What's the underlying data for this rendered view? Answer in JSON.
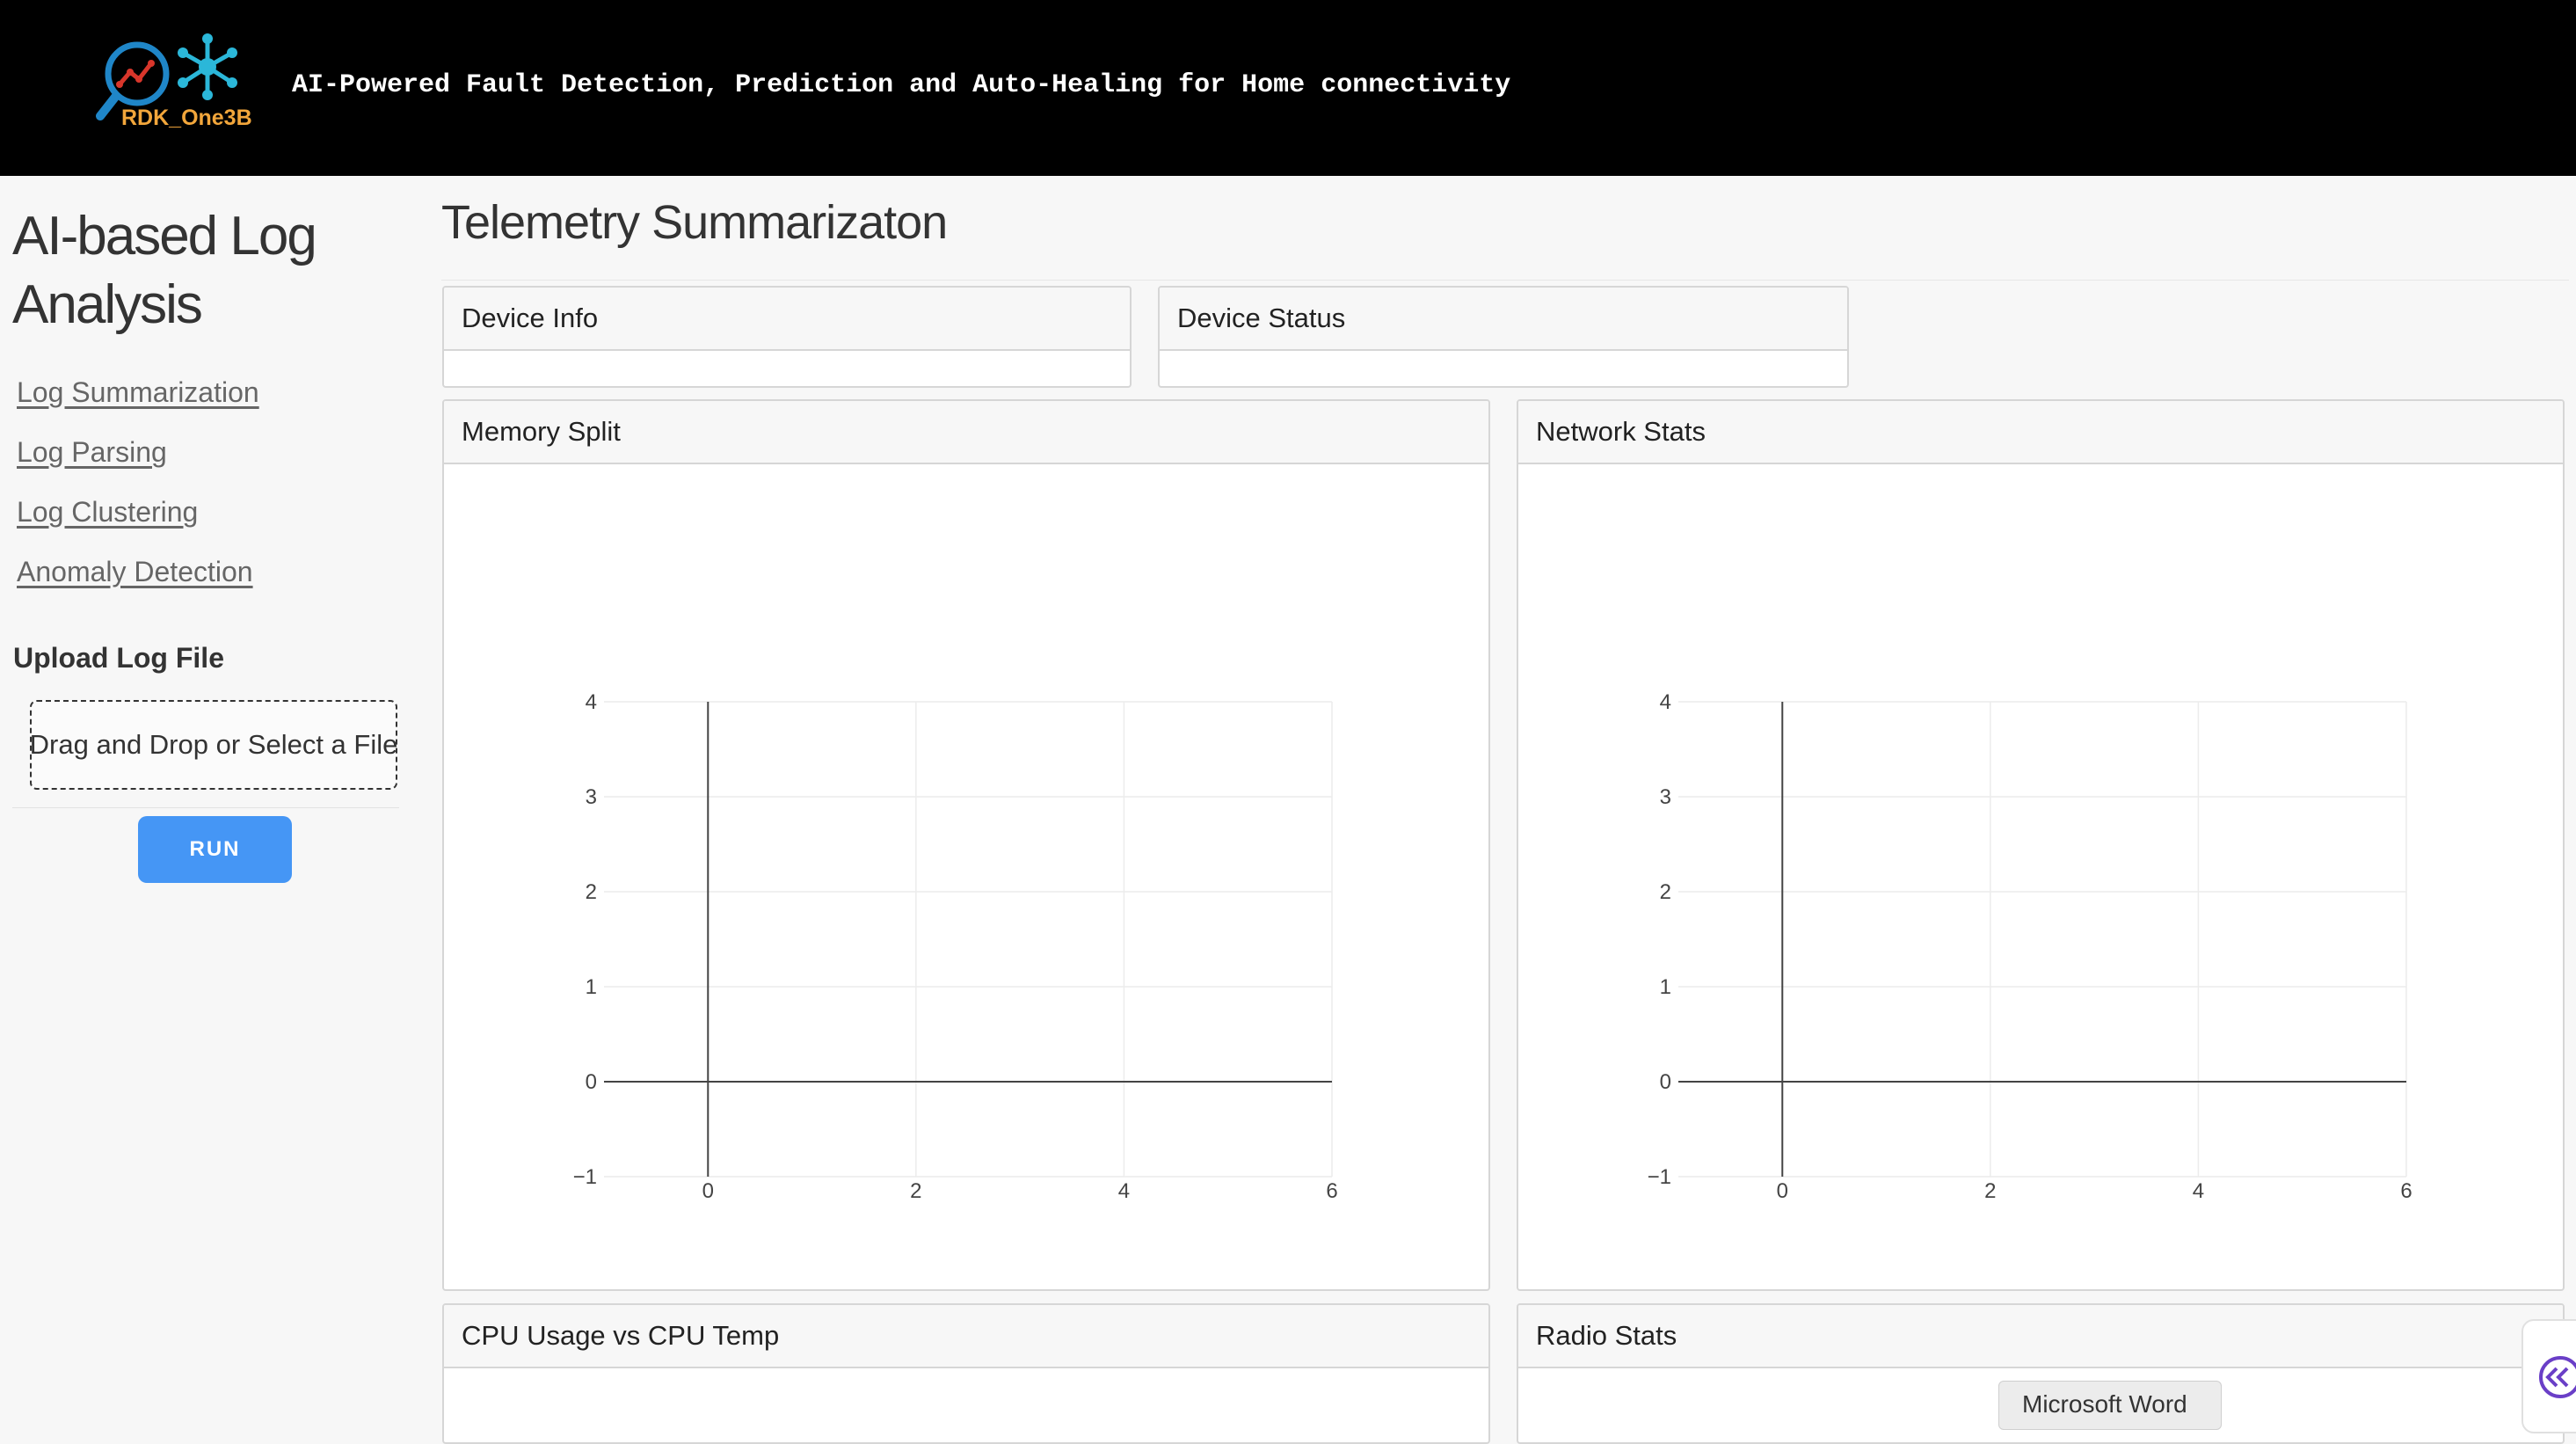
{
  "header": {
    "logo_text": "RDK_One3B",
    "tagline": "AI-Powered Fault Detection, Prediction and Auto-Healing for Home connectivity"
  },
  "sidebar": {
    "title": "AI-based Log Analysis",
    "nav": [
      {
        "label": "Log Summarization"
      },
      {
        "label": "Log Parsing"
      },
      {
        "label": "Log Clustering"
      },
      {
        "label": "Anomaly Detection"
      }
    ],
    "upload_label": "Upload Log File",
    "dropzone_text": "Drag and Drop or Select a File",
    "run_label": "RUN"
  },
  "main": {
    "title": "Telemetry Summarizaton",
    "cards": {
      "device_info": "Device Info",
      "device_status": "Device Status",
      "memory_split": "Memory Split",
      "network_stats": "Network Stats",
      "cpu_usage": "CPU Usage vs CPU Temp",
      "radio_stats": "Radio Stats"
    }
  },
  "chart_data": [
    {
      "type": "scatter",
      "title": "",
      "series": [],
      "xlim": [
        -1,
        6
      ],
      "ylim": [
        -1,
        4
      ],
      "xticks": [
        0,
        2,
        4,
        6
      ],
      "yticks": [
        -1,
        0,
        1,
        2,
        3,
        4
      ],
      "grid": true,
      "legend": "none"
    },
    {
      "type": "scatter",
      "title": "",
      "series": [],
      "xlim": [
        -1,
        6
      ],
      "ylim": [
        -1,
        4
      ],
      "xticks": [
        0,
        2,
        4,
        6
      ],
      "yticks": [
        -1,
        0,
        1,
        2,
        3,
        4
      ],
      "grid": true,
      "legend": "none"
    }
  ],
  "tooltip": "Microsoft Word",
  "colors": {
    "accent": "#4596f5",
    "header_bg": "#000000",
    "logo_text": "#f2a63b"
  }
}
